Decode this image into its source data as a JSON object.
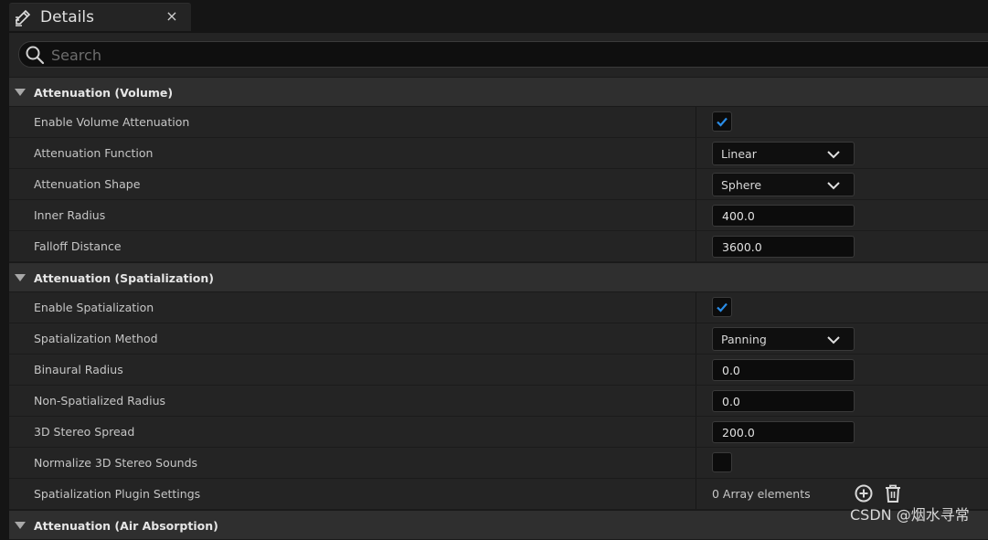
{
  "tab": {
    "title": "Details",
    "close": "×"
  },
  "search": {
    "placeholder": "Search"
  },
  "sections": {
    "volume": {
      "title": "Attenuation (Volume)",
      "enable_volume_attenuation": {
        "label": "Enable Volume Attenuation",
        "checked": true
      },
      "attenuation_function": {
        "label": "Attenuation Function",
        "value": "Linear"
      },
      "attenuation_shape": {
        "label": "Attenuation Shape",
        "value": "Sphere"
      },
      "inner_radius": {
        "label": "Inner Radius",
        "value": "400.0"
      },
      "falloff_distance": {
        "label": "Falloff Distance",
        "value": "3600.0"
      }
    },
    "spatialization": {
      "title": "Attenuation (Spatialization)",
      "enable_spatialization": {
        "label": "Enable Spatialization",
        "checked": true
      },
      "spatialization_method": {
        "label": "Spatialization Method",
        "value": "Panning"
      },
      "binaural_radius": {
        "label": "Binaural Radius",
        "value": "0.0"
      },
      "non_spatialized_radius": {
        "label": "Non-Spatialized Radius",
        "value": "0.0"
      },
      "stereo_spread": {
        "label": "3D Stereo Spread",
        "value": "200.0"
      },
      "normalize_stereo": {
        "label": "Normalize 3D Stereo Sounds",
        "checked": false
      },
      "plugin_settings": {
        "label": "Spatialization Plugin Settings",
        "value": "0 Array elements"
      }
    },
    "air_absorption": {
      "title": "Attenuation (Air Absorption)"
    }
  },
  "watermark": "CSDN @烟水寻常",
  "colors": {
    "accent_check": "#2a8ce6",
    "panel_bg": "#242424",
    "header_bg": "#2f2f2f"
  },
  "icons": {
    "tab": "pencil-icon",
    "search": "search-icon",
    "dropdown": "chevron-down-icon",
    "add": "add-circle-icon",
    "delete": "trash-icon"
  }
}
